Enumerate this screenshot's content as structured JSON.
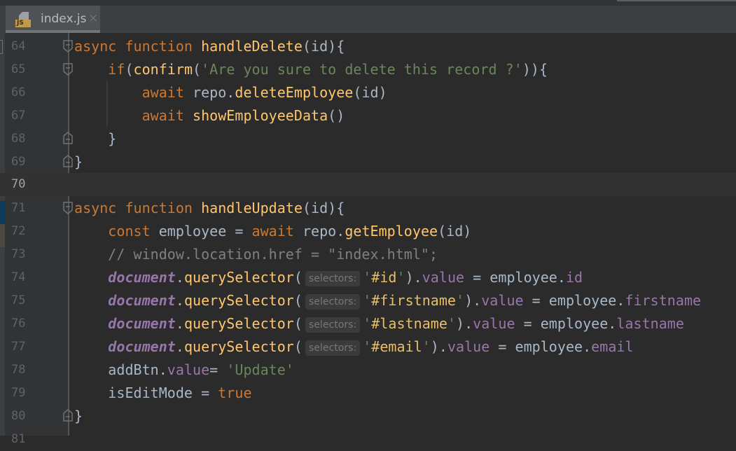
{
  "tab": {
    "filename": "index.js",
    "icon": "js-file-icon",
    "icon_badge": "JS",
    "close": "×"
  },
  "lines": [
    {
      "num": "64"
    },
    {
      "num": "65"
    },
    {
      "num": "66"
    },
    {
      "num": "67"
    },
    {
      "num": "68"
    },
    {
      "num": "69"
    },
    {
      "num": "70"
    },
    {
      "num": "71"
    },
    {
      "num": "72"
    },
    {
      "num": "73"
    },
    {
      "num": "74"
    },
    {
      "num": "75"
    },
    {
      "num": "76"
    },
    {
      "num": "77"
    },
    {
      "num": "78"
    },
    {
      "num": "79"
    },
    {
      "num": "80"
    },
    {
      "num": "81"
    }
  ],
  "current_line": "70",
  "code": {
    "l64": {
      "kw1": "async",
      "kw2": "function",
      "name": "handleDelete",
      "rest": "(id){"
    },
    "l65": {
      "kw": "if",
      "p1": "(",
      "fn": "confirm",
      "p2": "(",
      "str": "'Are you sure to delete this record ?'",
      "rest": ")){"
    },
    "l66": {
      "kw": "await",
      "obj": "repo.",
      "fn": "deleteEmployee",
      "rest": "(id)"
    },
    "l67": {
      "kw": "await",
      "fn": "showEmployeeData",
      "rest": "()"
    },
    "l68": {
      "rest": "}"
    },
    "l69": {
      "rest": "}"
    },
    "l71": {
      "kw1": "async",
      "kw2": "function",
      "name": "handleUpdate",
      "rest": "(id){"
    },
    "l72": {
      "kw": "const",
      "var": "employee = ",
      "kw2": "await",
      "obj": "repo.",
      "fn": "getEmployee",
      "rest": "(id)"
    },
    "l73": {
      "comment": "// window.location.href = \"index.html\";"
    },
    "l74": {
      "glob": "document",
      "dot": ".",
      "fn": "querySelector",
      "open": "(",
      "hint": "selectors:",
      "q1": "'",
      "sel": "#id",
      "q2": "'",
      "close": ")",
      "prop": "value",
      "mid": " = employee.",
      "field": "id"
    },
    "l75": {
      "glob": "document",
      "dot": ".",
      "fn": "querySelector",
      "open": "(",
      "hint": "selectors:",
      "q1": "'",
      "sel": "#firstname",
      "q2": "'",
      "close": ")",
      "prop": "value",
      "mid": " = employee.",
      "field": "firstname"
    },
    "l76": {
      "glob": "document",
      "dot": ".",
      "fn": "querySelector",
      "open": "(",
      "hint": "selectors:",
      "q1": "'",
      "sel": "#lastname",
      "q2": "'",
      "close": ")",
      "prop": "value",
      "mid": " = employee.",
      "field": "lastname"
    },
    "l77": {
      "glob": "document",
      "dot": ".",
      "fn": "querySelector",
      "open": "(",
      "hint": "selectors:",
      "q1": "'",
      "sel": "#email",
      "q2": "'",
      "close": ")",
      "prop": "value",
      "mid": " = employee.",
      "field": "email"
    },
    "l78": {
      "obj": "addBtn.",
      "prop": "value",
      "eq": "= ",
      "str": "'Update'"
    },
    "l79": {
      "var": "isEditMode = ",
      "kw": "true"
    },
    "l80": {
      "rest": "}"
    }
  },
  "colors": {
    "background": "#2b2b2b",
    "keyword": "#cc7832",
    "function": "#ffc66d",
    "string": "#6a8759",
    "comment": "#808080",
    "property": "#9876aa",
    "identifier": "#a9b7c6"
  }
}
